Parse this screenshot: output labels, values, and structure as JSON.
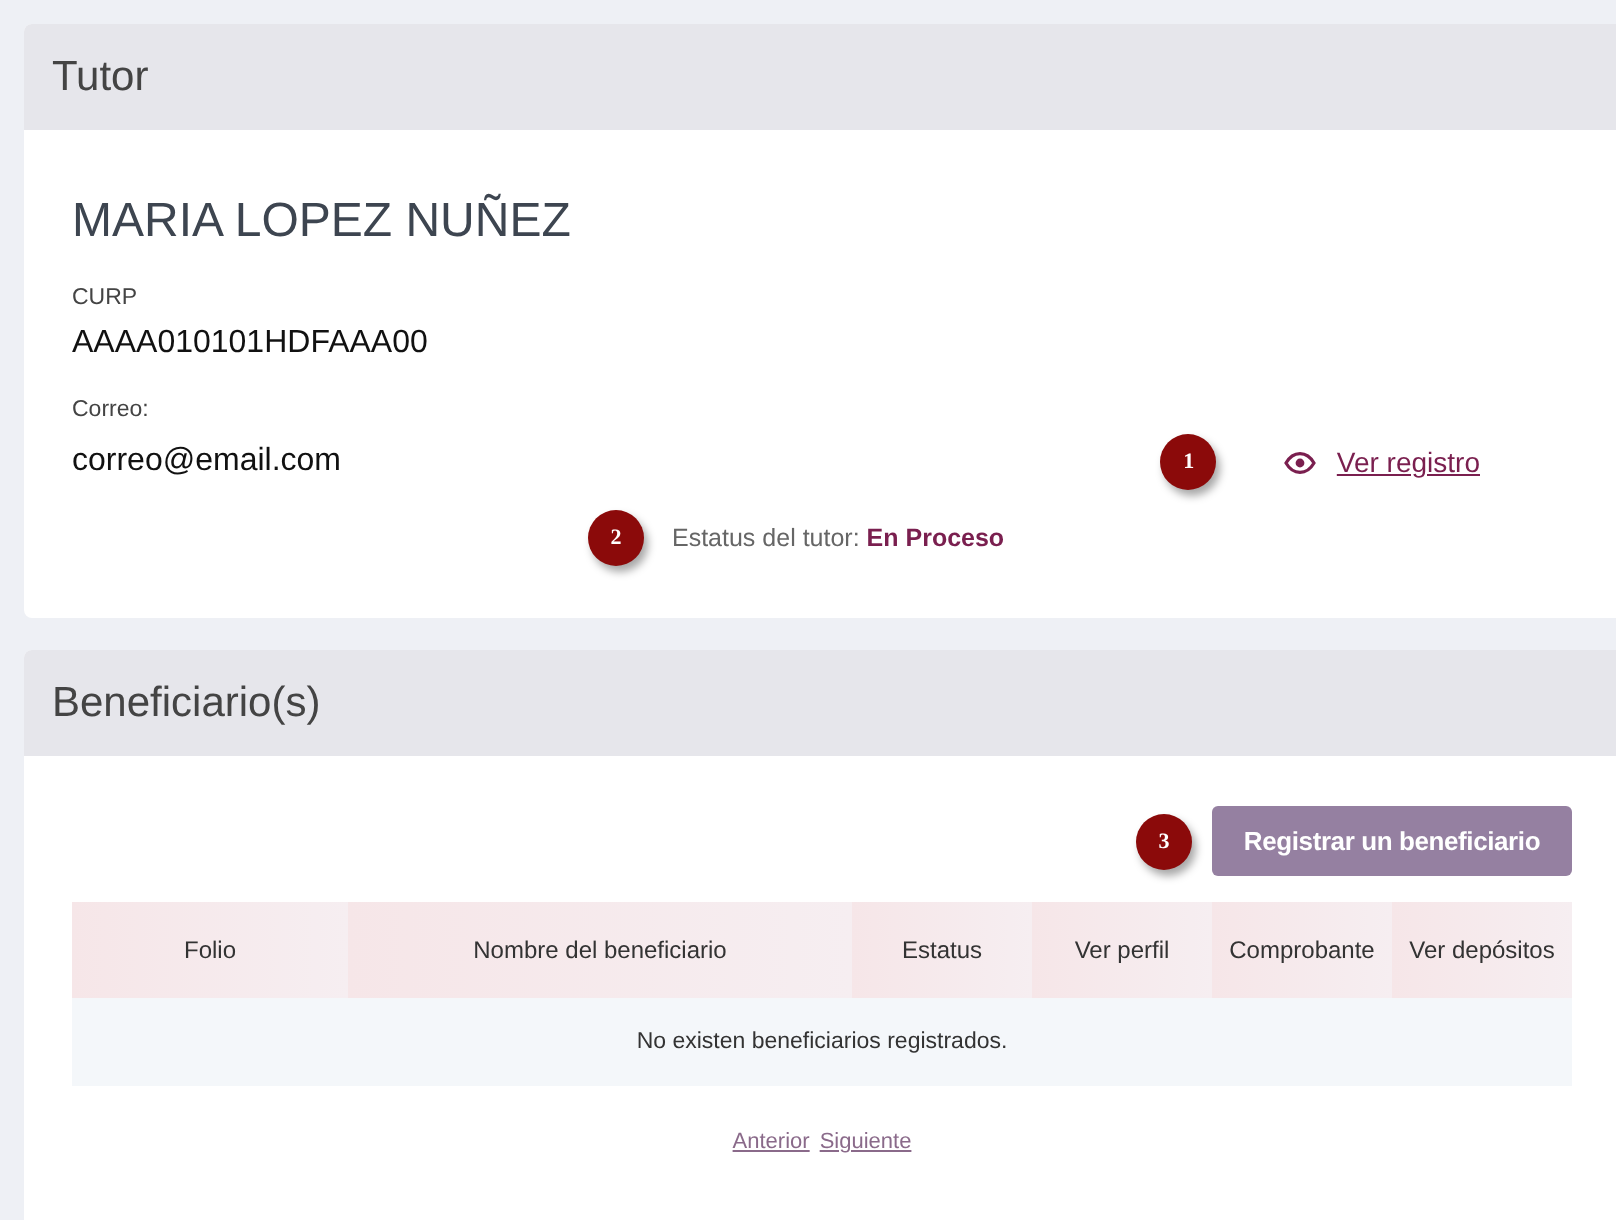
{
  "tutor_section": {
    "title": "Tutor",
    "name": "MARIA LOPEZ NUÑEZ",
    "curp_label": "CURP",
    "curp": "AAAA010101HDFAAA00",
    "email_label": "Correo:",
    "email": "correo@email.com",
    "view_marker": "1",
    "view_link": "Ver registro",
    "status_marker": "2",
    "status_label": "Estatus del tutor:",
    "status_value": "En Proceso"
  },
  "beneficiaries_section": {
    "title": "Beneficiario(s)",
    "register_marker": "3",
    "register_button": "Registrar un beneficiario",
    "table": {
      "columns": [
        "Folio",
        "Nombre del beneficiario",
        "Estatus",
        "Ver perfil",
        "Comprobante",
        "Ver depósitos"
      ],
      "empty_message": "No existen beneficiarios registrados."
    },
    "pagination": [
      "Anterior",
      "Siguiente"
    ]
  }
}
